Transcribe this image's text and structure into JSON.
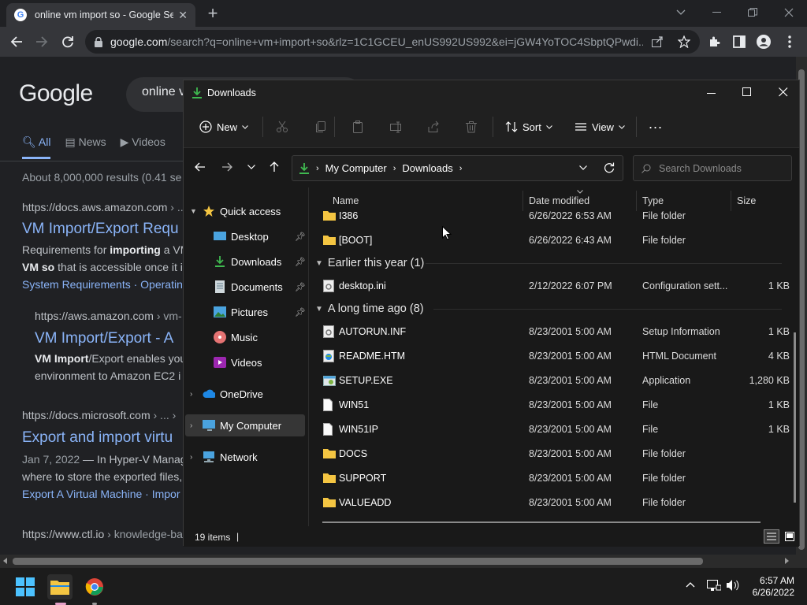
{
  "browser": {
    "tab_title": "online vm import so - Google Se",
    "url_domain": "google.com",
    "url_rest": "/search?q=online+vm+import+so&rlz=1C1GCEU_enUS992US992&ei=jGW4YoTOC4SbptQPwdi..."
  },
  "google": {
    "logo": "Google",
    "query": "online v",
    "tabs": {
      "all": "All",
      "news": "News",
      "videos": "Videos"
    },
    "results_count": "About 8,000,000 results (0.41 se",
    "r1_cite": "https://docs.aws.amazon.com",
    "r1_cite_rest": " › ...",
    "r1_title": "VM Import/Export Requ",
    "r1_desc_1a": "Requirements for ",
    "r1_desc_1b": "importing",
    "r1_desc_1c": " a VM",
    "r1_desc_2a": "VM so",
    "r1_desc_2b": " that is accessible once it i",
    "r1_links": "System Requirements · Operating",
    "r2_cite": "https://aws.amazon.com",
    "r2_cite_rest": " › vm-",
    "r2_title": "VM Import/Export - A",
    "r2_desc_1a": "VM Import",
    "r2_desc_1b": "/Export enables you",
    "r2_desc_2": "environment to Amazon EC2 i",
    "r3_cite": "https://docs.microsoft.com",
    "r3_cite_rest": " › ... ›",
    "r3_title": "Export and import virtu",
    "r3_desc_1a": "Jan 7, 2022",
    "r3_desc_1b": " — In Hyper-V Manag",
    "r3_desc_2": "where to store the exported files,",
    "r3_links": "Export A Virtual Machine · Impor",
    "r4_cite": "https://www.ctl.io",
    "r4_cite_rest": " › knowledge-ba"
  },
  "explorer": {
    "title": "Downloads",
    "new_label": "New",
    "sort_label": "Sort",
    "view_label": "View",
    "more_label": "...",
    "breadcrumb": [
      "My Computer",
      "Downloads"
    ],
    "search_placeholder": "Search Downloads",
    "nav": {
      "quick_access": "Quick access",
      "desktop": "Desktop",
      "downloads": "Downloads",
      "documents": "Documents",
      "pictures": "Pictures",
      "music": "Music",
      "videos": "Videos",
      "onedrive": "OneDrive",
      "my_computer": "My Computer",
      "network": "Network"
    },
    "columns": {
      "name": "Name",
      "date": "Date modified",
      "type": "Type",
      "size": "Size"
    },
    "groups": {
      "earlier": "Earlier this year (1)",
      "long_ago": "A long time ago (8)"
    },
    "files": [
      {
        "name": "I386",
        "date": "6/26/2022 6:53 AM",
        "type": "File folder",
        "size": "",
        "icon": "folder-icon"
      },
      {
        "name": "[BOOT]",
        "date": "6/26/2022 6:43 AM",
        "type": "File folder",
        "size": "",
        "icon": "folder-icon"
      },
      {
        "name": "desktop.ini",
        "date": "2/12/2022 6:07 PM",
        "type": "Configuration sett...",
        "size": "1 KB",
        "icon": "config-file-icon"
      },
      {
        "name": "AUTORUN.INF",
        "date": "8/23/2001 5:00 AM",
        "type": "Setup Information",
        "size": "1 KB",
        "icon": "setup-info-icon"
      },
      {
        "name": "README.HTM",
        "date": "8/23/2001 5:00 AM",
        "type": "HTML Document",
        "size": "4 KB",
        "icon": "html-document-icon"
      },
      {
        "name": "SETUP.EXE",
        "date": "8/23/2001 5:00 AM",
        "type": "Application",
        "size": "1,280 KB",
        "icon": "application-icon"
      },
      {
        "name": "WIN51",
        "date": "8/23/2001 5:00 AM",
        "type": "File",
        "size": "1 KB",
        "icon": "file-icon"
      },
      {
        "name": "WIN51IP",
        "date": "8/23/2001 5:00 AM",
        "type": "File",
        "size": "1 KB",
        "icon": "file-icon"
      },
      {
        "name": "DOCS",
        "date": "8/23/2001 5:00 AM",
        "type": "File folder",
        "size": "",
        "icon": "folder-icon"
      },
      {
        "name": "SUPPORT",
        "date": "8/23/2001 5:00 AM",
        "type": "File folder",
        "size": "",
        "icon": "folder-icon"
      },
      {
        "name": "VALUEADD",
        "date": "8/23/2001 5:00 AM",
        "type": "File folder",
        "size": "",
        "icon": "folder-icon"
      }
    ],
    "status": "19 items",
    "status_cursor": "|"
  },
  "taskbar": {
    "time": "6:57 AM",
    "date": "6/26/2022"
  },
  "colors": {
    "accent_link": "#8ab4f8",
    "folder": "#f4c542",
    "download_green": "#3fb950"
  }
}
